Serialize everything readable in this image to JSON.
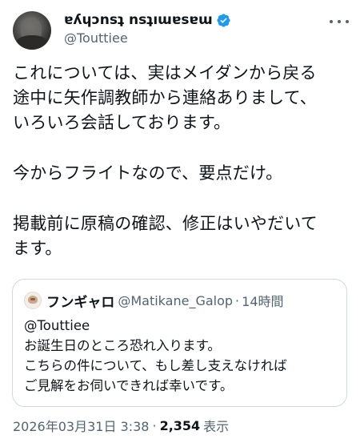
{
  "author": {
    "display_name": "ɐʎɥɔnsʇ nsʇıɯɐsɐɯ",
    "handle": "@Touttiee"
  },
  "tweet": {
    "line1": "これについては、実はメイダンから戻る",
    "line2": "途中に矢作調教師から連絡ありまして、",
    "line3": "いろいろ会話しております。",
    "line4": "今からフライトなので、要点だけ。",
    "line5": "掲載前に原稿の確認、修正はいやだいて",
    "line6": "ます。"
  },
  "quote": {
    "name": "フンギャロ",
    "handle": "@Matikane_Galop",
    "separator": "·",
    "time": "14時間",
    "line1": "@Touttiee",
    "line2": "お誕生日のところ恐れ入ります。",
    "line3": "こちらの件について、もし差し支えなければ",
    "line4": "ご見解をお伺いできれば幸いです。"
  },
  "meta": {
    "datetime": "2026年03月31日 3:38",
    "separator": "·",
    "views_count": "2,354",
    "views_label": "表示"
  },
  "colors": {
    "verified": "#1d9bf0",
    "secondary_text": "#536471",
    "primary_text": "#0f1419",
    "border": "#cfd9de"
  },
  "icons": {
    "verified": "verified-badge-icon",
    "more": "more-options-icon"
  }
}
